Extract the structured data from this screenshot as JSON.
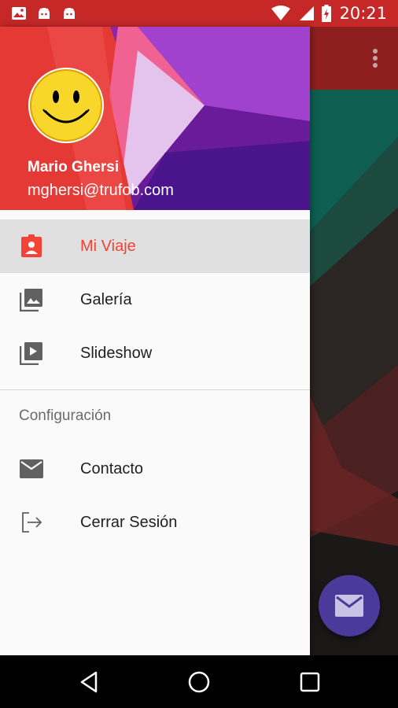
{
  "status_bar": {
    "time": "20:21",
    "left_icons": [
      "image-icon",
      "android-icon",
      "android-icon"
    ],
    "right_icons": [
      "wifi-icon",
      "signal-icon",
      "battery-charging-icon"
    ]
  },
  "drawer": {
    "header": {
      "user_name": "Mario Ghersi",
      "user_email": "mghersi@trufob.com",
      "avatar": "smiley-face"
    },
    "items": [
      {
        "label": "Mi Viaje",
        "icon": "assignment-ind-icon",
        "active": true
      },
      {
        "label": "Galería",
        "icon": "photo-library-icon",
        "active": false
      },
      {
        "label": "Slideshow",
        "icon": "slideshow-icon",
        "active": false
      }
    ],
    "section": {
      "title": "Configuración",
      "items": [
        {
          "label": "Contacto",
          "icon": "email-icon"
        },
        {
          "label": "Cerrar Sesión",
          "icon": "logout-icon"
        }
      ]
    }
  },
  "background_app": {
    "menu_icon": "overflow-menu-icon",
    "fab_icon": "email-icon"
  },
  "colors": {
    "status_bar": "#c62828",
    "accent": "#f44336",
    "active_bg": "#e0e0e0",
    "fab": "#4a3a9a"
  },
  "nav_bar": {
    "buttons": [
      "back-icon",
      "home-icon",
      "recents-icon"
    ]
  }
}
